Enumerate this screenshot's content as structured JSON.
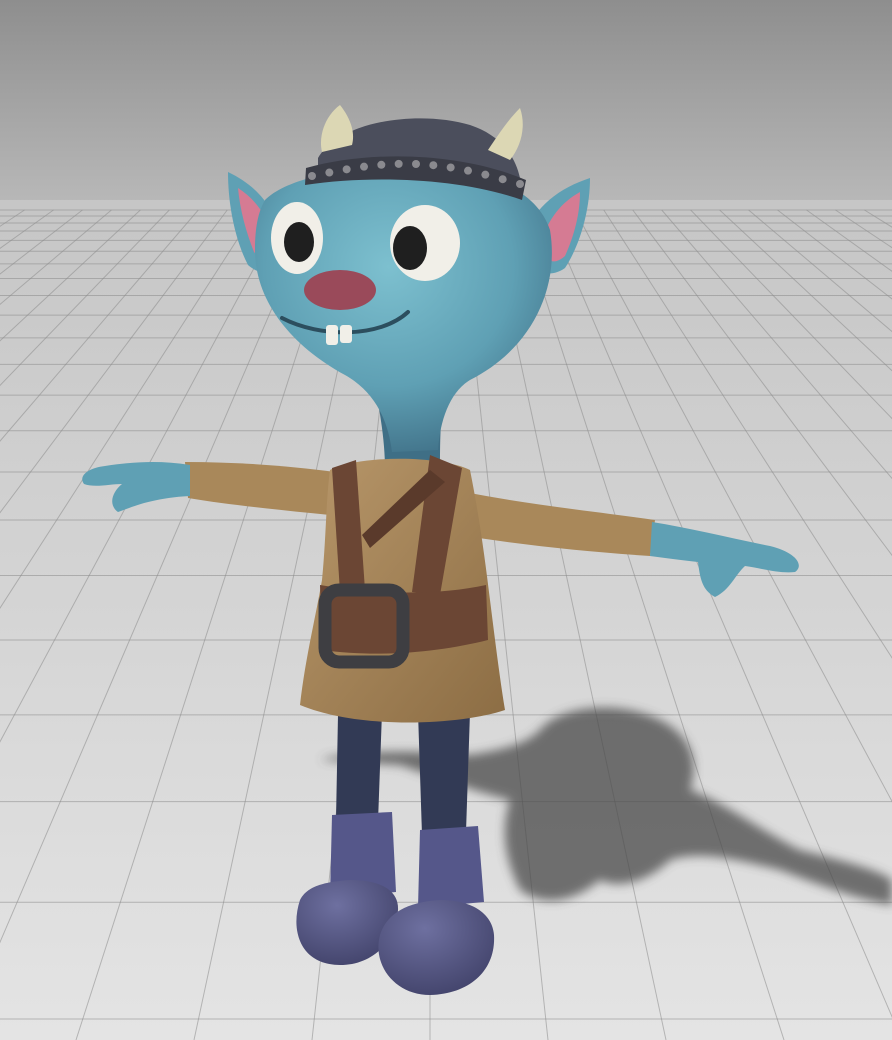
{
  "scene": {
    "colors": {
      "sky_top": "#8e8e8e",
      "sky_horizon": "#c4c4c4",
      "floor_far": "#c6c6c6",
      "floor_near": "#e4e4e4",
      "grid_line": "#8c8c8c",
      "shadow": "#4a4a4a",
      "skin": "#5fa0b4",
      "skin_light": "#7dc0cf",
      "skin_dark": "#3f6f86",
      "ear_inner": "#d57b93",
      "nose": "#9a4a5a",
      "eye_white": "#f1efe8",
      "pupil": "#1f1f1f",
      "helmet": "#4b4e5c",
      "helmet_band": "#3a3c46",
      "rivet": "#8a8a8f",
      "horn": "#dcd7b4",
      "tunic": "#a9885a",
      "tunic_dark": "#8c6d44",
      "leather": "#6b4634",
      "leather_dark": "#4d2f22",
      "buckle": "#3e3e42",
      "legs": "#323a55",
      "boots": "#5c5d8a",
      "boots_dark": "#3f4067"
    },
    "icons": [
      "character-model",
      "floor-grid",
      "drop-shadow"
    ]
  }
}
